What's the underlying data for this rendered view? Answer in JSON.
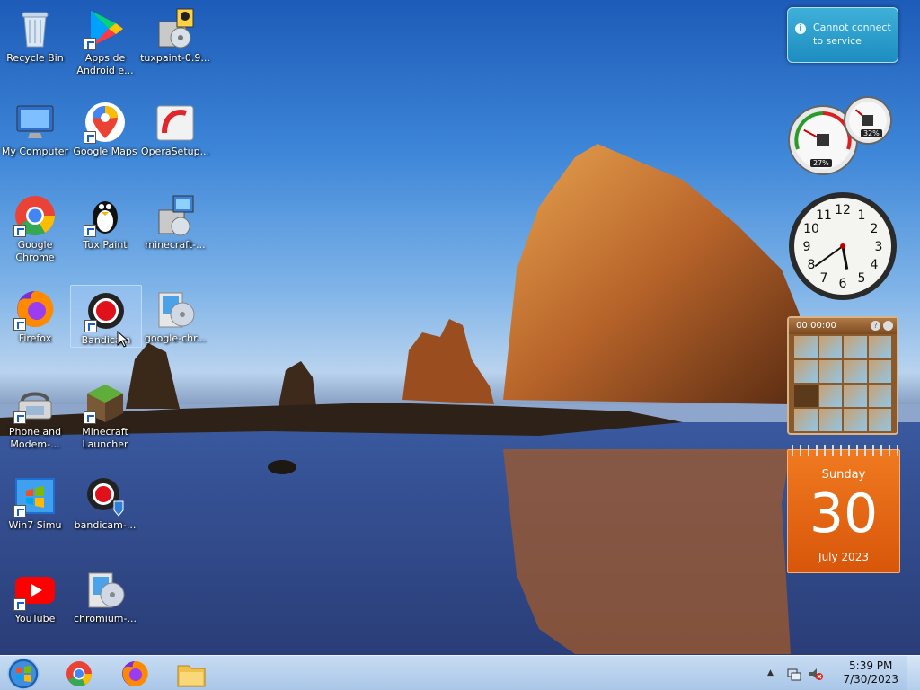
{
  "desktop_icons": [
    {
      "name": "Recycle Bin",
      "icon": "recycle-bin-icon"
    },
    {
      "name": "Apps de Android e...",
      "icon": "google-play-icon"
    },
    {
      "name": "tuxpaint-0.9...",
      "icon": "installer-icon"
    },
    {
      "name": "My Computer",
      "icon": "computer-icon"
    },
    {
      "name": "Google Maps",
      "icon": "google-maps-icon"
    },
    {
      "name": "OperaSetup...",
      "icon": "opera-installer-icon"
    },
    {
      "name": "Google Chrome",
      "icon": "chrome-icon"
    },
    {
      "name": "Tux Paint",
      "icon": "tux-icon"
    },
    {
      "name": "minecraft-...",
      "icon": "installer-icon"
    },
    {
      "name": "Firefox",
      "icon": "firefox-icon"
    },
    {
      "name": "Bandicam",
      "icon": "bandicam-icon"
    },
    {
      "name": "google-chr...",
      "icon": "installer-disc-icon"
    },
    {
      "name": "Phone and Modem-...",
      "icon": "phone-modem-icon"
    },
    {
      "name": "Minecraft Launcher",
      "icon": "minecraft-icon"
    },
    {
      "name": "Win7 Simu",
      "icon": "win7-simu-icon"
    },
    {
      "name": "bandicam-...",
      "icon": "bandicam-installer-icon"
    },
    {
      "name": "YouTube",
      "icon": "youtube-icon"
    },
    {
      "name": "chromium-...",
      "icon": "installer-disc-icon"
    }
  ],
  "gadgets": {
    "notification": {
      "text": "Cannot connect to service"
    },
    "cpu_meter": {
      "cpu": "27%",
      "memory": "32%",
      "cpu_value": 27,
      "memory_value": 32
    },
    "clock": {
      "hour": 5,
      "minute": 39
    },
    "puzzle": {
      "timer": "00:00:00"
    },
    "calendar": {
      "weekday": "Sunday",
      "day": "30",
      "month_year": "July 2023"
    }
  },
  "taskbar": {
    "pinned": [
      "start-orb-icon",
      "chrome-icon",
      "firefox-icon",
      "file-explorer-icon"
    ],
    "time": "5:39 PM",
    "date": "7/30/2023"
  },
  "colors": {
    "taskbar": "#b8d1ee",
    "calendar": "#e8650f",
    "accent": "#1d8cc0"
  }
}
